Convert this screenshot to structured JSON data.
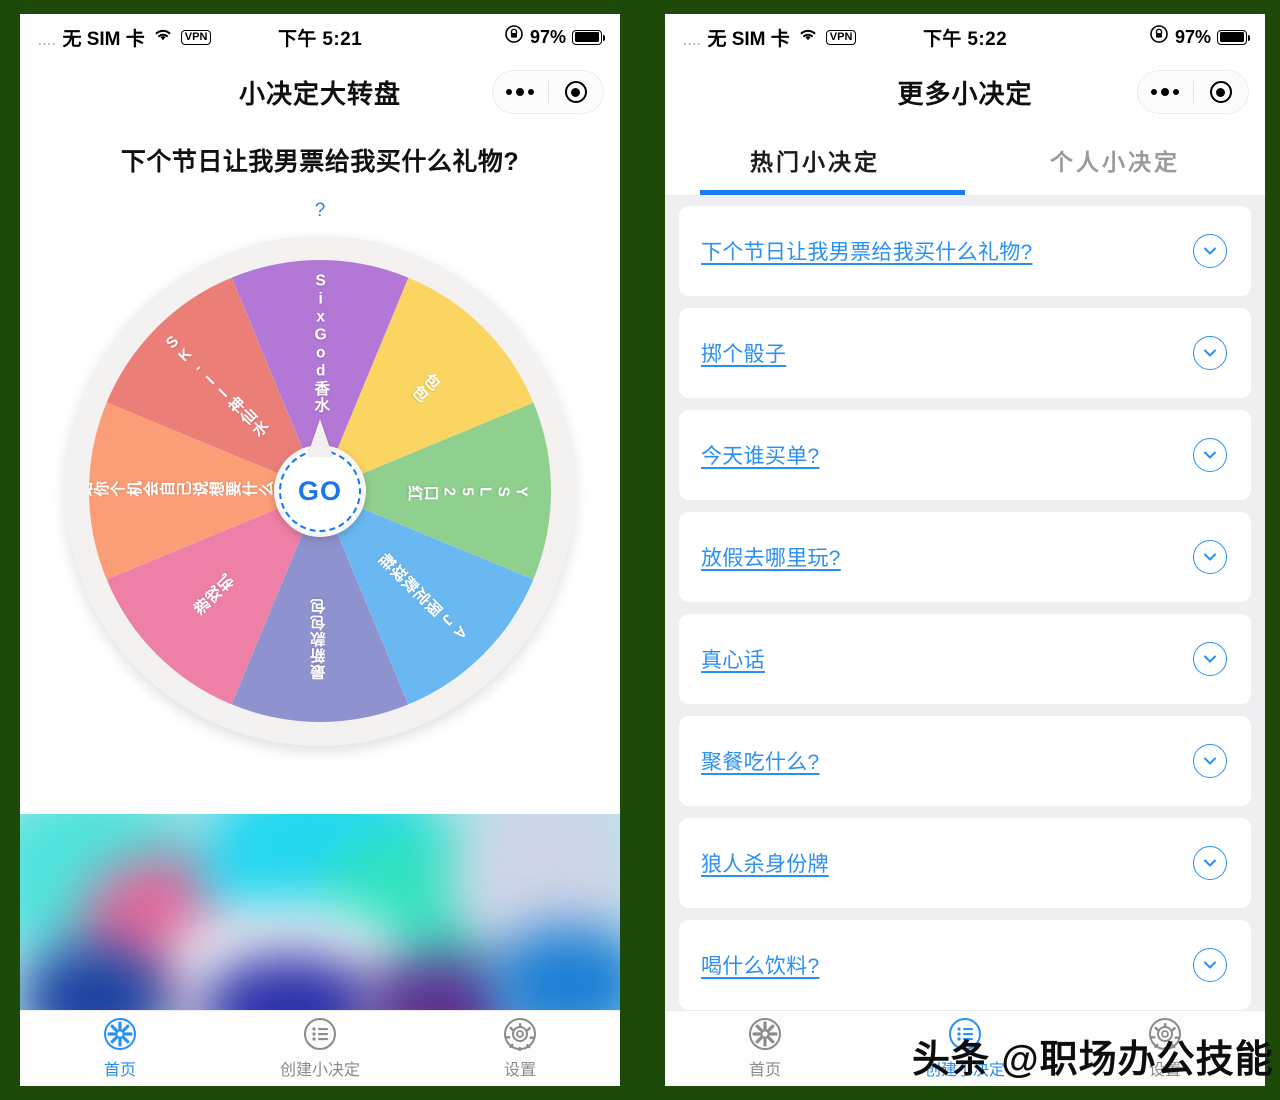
{
  "status_bar": {
    "signal_dots": "....",
    "carrier": "无 SIM 卡",
    "vpn": "VPN",
    "time_left": "下午 5:21",
    "time_right": "下午 5:22",
    "battery_percent": "97%"
  },
  "left_phone": {
    "nav": {
      "title": "小决定大转盘"
    },
    "question": "下个节日让我男票给我买什么礼物?",
    "hint": "?",
    "wheel": {
      "go_label": "GO",
      "segments": [
        {
          "label": "SixGod香水",
          "color": "#ec7e78"
        },
        {
          "label": "包包",
          "color": "#b377d6"
        },
        {
          "label": "YSL52口红",
          "color": "#fbd561"
        },
        {
          "label": "AJ限定款球鞋",
          "color": "#8fd08f"
        },
        {
          "label": "最新款包包",
          "color": "#6ab8f2"
        },
        {
          "label": "游戏机",
          "color": "#8e93cf"
        },
        {
          "label": "给你个机会自己说想要什么",
          "color": "#ee7fa6"
        },
        {
          "label": "SK-II神仙水",
          "color": "#fb9e77"
        }
      ]
    },
    "tabbar": [
      {
        "label": "首页",
        "icon": "wheel-icon",
        "active": true
      },
      {
        "label": "创建小决定",
        "icon": "list-icon",
        "active": false
      },
      {
        "label": "设置",
        "icon": "gear-icon",
        "active": false
      }
    ]
  },
  "right_phone": {
    "nav": {
      "title": "更多小决定"
    },
    "tabs": [
      {
        "label": "热门小决定",
        "active": true
      },
      {
        "label": "个人小决定",
        "active": false
      }
    ],
    "list": [
      {
        "label": "下个节日让我男票给我买什么礼物? "
      },
      {
        "label": "掷个骰子"
      },
      {
        "label": "今天谁买单? "
      },
      {
        "label": "放假去哪里玩? "
      },
      {
        "label": "真心话"
      },
      {
        "label": "聚餐吃什么? "
      },
      {
        "label": "狼人杀身份牌"
      },
      {
        "label": "喝什么饮料? "
      }
    ],
    "tabbar": [
      {
        "label": "首页",
        "icon": "wheel-icon",
        "active": false
      },
      {
        "label": "创建小决定",
        "icon": "list-icon",
        "active": true
      },
      {
        "label": "设置",
        "icon": "gear-icon",
        "active": false
      }
    ]
  },
  "watermark": {
    "text": "头条 @职场办公技能"
  },
  "colors": {
    "accent_blue": "#2a90f5",
    "tab_active": "#1a7bf2",
    "page_bg": "#efeff1",
    "frame_green": "#1e4a09"
  }
}
